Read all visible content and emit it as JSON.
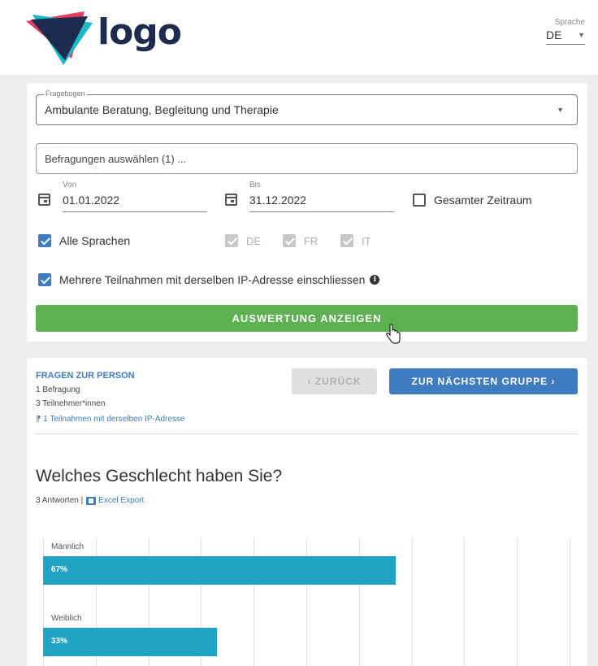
{
  "header": {
    "logo_text": "logo",
    "language_label": "Sprache",
    "language_value": "DE"
  },
  "filters": {
    "questionnaire_legend": "Fragebogen",
    "questionnaire_value": "Ambulante Beratung, Begleitung und Therapie",
    "surveys_select": "Befragungen auswählen (1) ...",
    "from_label": "Von",
    "from_value": "01.01.2022",
    "to_label": "Bis",
    "to_value": "31.12.2022",
    "whole_period_label": "Gesamter Zeitraum",
    "all_languages_label": "Alle Sprachen",
    "languages": [
      "DE",
      "FR",
      "IT"
    ],
    "multi_ip_label": "Mehrere Teilnahmen mit derselben IP-Adresse einschliessen",
    "show_button": "AUSWERTUNG ANZEIGEN"
  },
  "group": {
    "title": "FRAGEN ZUR PERSON",
    "surveys": "1 Befragung",
    "participants": "3 Teilnehmer*innen",
    "ip_note": "1 Teilnahmen mit derselben IP-Adresse",
    "back_button": "‹ ZURÜCK",
    "next_button": "ZUR NÄCHSTEN GRUPPE ›"
  },
  "question": {
    "title": "Welches Geschlecht haben Sie?",
    "answers_text": "3 Antworten |",
    "excel_export": "Excel Export"
  },
  "colors": {
    "green": "#5db151",
    "blue": "#3f7cc0",
    "bar": "#1fa4c4"
  },
  "chart_data": {
    "type": "bar",
    "orientation": "horizontal",
    "categories": [
      "Männlich",
      "Weiblich"
    ],
    "values": [
      67,
      33
    ],
    "value_labels": [
      "67%",
      "33%"
    ],
    "xlim": [
      0,
      100
    ],
    "grid": true
  }
}
